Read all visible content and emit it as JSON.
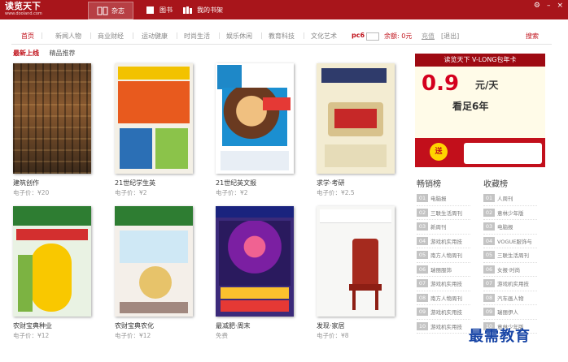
{
  "app": {
    "logo": "读览天下",
    "logo_sub": "www.dooland.com",
    "nav": [
      "杂志",
      "图书",
      "我的书架"
    ],
    "window_buttons": [
      "⚙",
      "–",
      "×"
    ]
  },
  "categories": [
    "首页",
    "新闻人物",
    "商业财经",
    "运动健康",
    "时尚生活",
    "娱乐休闲",
    "教育科技",
    "文化艺术"
  ],
  "account": {
    "user": "pc6",
    "balance": "余额: 0元",
    "recharge": "充值",
    "logout": "[退出]",
    "search": "搜索"
  },
  "subtabs": [
    "最新上线",
    "精品推荐"
  ],
  "books": [
    {
      "title": "建筑创作",
      "price": "电子价：¥20",
      "cover": "brown"
    },
    {
      "title": "21世纪学生英",
      "price": "电子价：¥2",
      "cover": "teens"
    },
    {
      "title": "21世纪英文报",
      "price": "电子价：¥2",
      "cover": "century"
    },
    {
      "title": "求学·考研",
      "price": "电子价：¥2.5",
      "cover": "qiuxue"
    },
    {
      "title": "农财宝典种业",
      "price": "电子价：¥12",
      "cover": "corn"
    },
    {
      "title": "农财宝典农化",
      "price": "电子价：¥12",
      "cover": "pig"
    },
    {
      "title": "最减肥·周末",
      "price": "免费",
      "cover": "purple"
    },
    {
      "title": "发现·家居",
      "price": "电子价：¥8",
      "cover": "chair"
    }
  ],
  "ad": {
    "headline": "读览天下 V-LONG包年卡",
    "price": "0.9",
    "unit": "元/天",
    "slogan": "看足6年",
    "send": "送"
  },
  "rankings": {
    "bestseller": {
      "title": "畅销榜",
      "items": [
        {
          "num": "01",
          "name": "电脑报"
        },
        {
          "num": "02",
          "name": "三联生活周刊"
        },
        {
          "num": "03",
          "name": "新周刊"
        },
        {
          "num": "04",
          "name": "游戏机实用技"
        },
        {
          "num": "05",
          "name": "南方人物周刊"
        },
        {
          "num": "06",
          "name": "瑞丽服饰"
        },
        {
          "num": "07",
          "name": "游戏机实用技"
        },
        {
          "num": "08",
          "name": "南方人物周刊"
        },
        {
          "num": "09",
          "name": "游戏机实用技"
        },
        {
          "num": "10",
          "name": "游戏机实用技"
        }
      ]
    },
    "favorites": {
      "title": "收藏榜",
      "items": [
        {
          "num": "01",
          "name": "人周刊"
        },
        {
          "num": "02",
          "name": "意林少年版"
        },
        {
          "num": "03",
          "name": "电脑报"
        },
        {
          "num": "04",
          "name": "VOGUE服饰与"
        },
        {
          "num": "05",
          "name": "三联生活周刊"
        },
        {
          "num": "06",
          "name": "女报·时尚"
        },
        {
          "num": "07",
          "name": "游戏机实用技"
        },
        {
          "num": "08",
          "name": "汽车画人物"
        },
        {
          "num": "09",
          "name": "瑞丽伊人"
        },
        {
          "num": "10",
          "name": "意林少年版"
        }
      ]
    }
  },
  "watermark": "最需教育",
  "colors": {
    "brand": "#a8151b",
    "accent": "#c0121b"
  }
}
